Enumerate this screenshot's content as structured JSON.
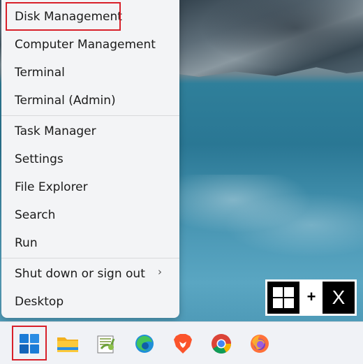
{
  "menu": {
    "items": [
      {
        "label": "Disk Management"
      },
      {
        "label": "Computer Management"
      },
      {
        "label": "Terminal"
      },
      {
        "label": "Terminal (Admin)"
      },
      {
        "label": "Task Manager"
      },
      {
        "label": "Settings"
      },
      {
        "label": "File Explorer"
      },
      {
        "label": "Search"
      },
      {
        "label": "Run"
      },
      {
        "label": "Shut down or sign out"
      },
      {
        "label": "Desktop"
      }
    ],
    "submenu_chevron": "›"
  },
  "shortcut": {
    "plus": "+",
    "key_label": "X"
  },
  "taskbar": {
    "icons": [
      "windows-start-icon",
      "file-explorer-icon",
      "notepad-plus-plus-icon",
      "edge-icon",
      "brave-icon",
      "chrome-icon",
      "firefox-icon"
    ]
  },
  "colors": {
    "highlight": "#d8202a",
    "menu_bg": "#f3f4f6",
    "taskbar_bg": "#f0f2f6"
  }
}
